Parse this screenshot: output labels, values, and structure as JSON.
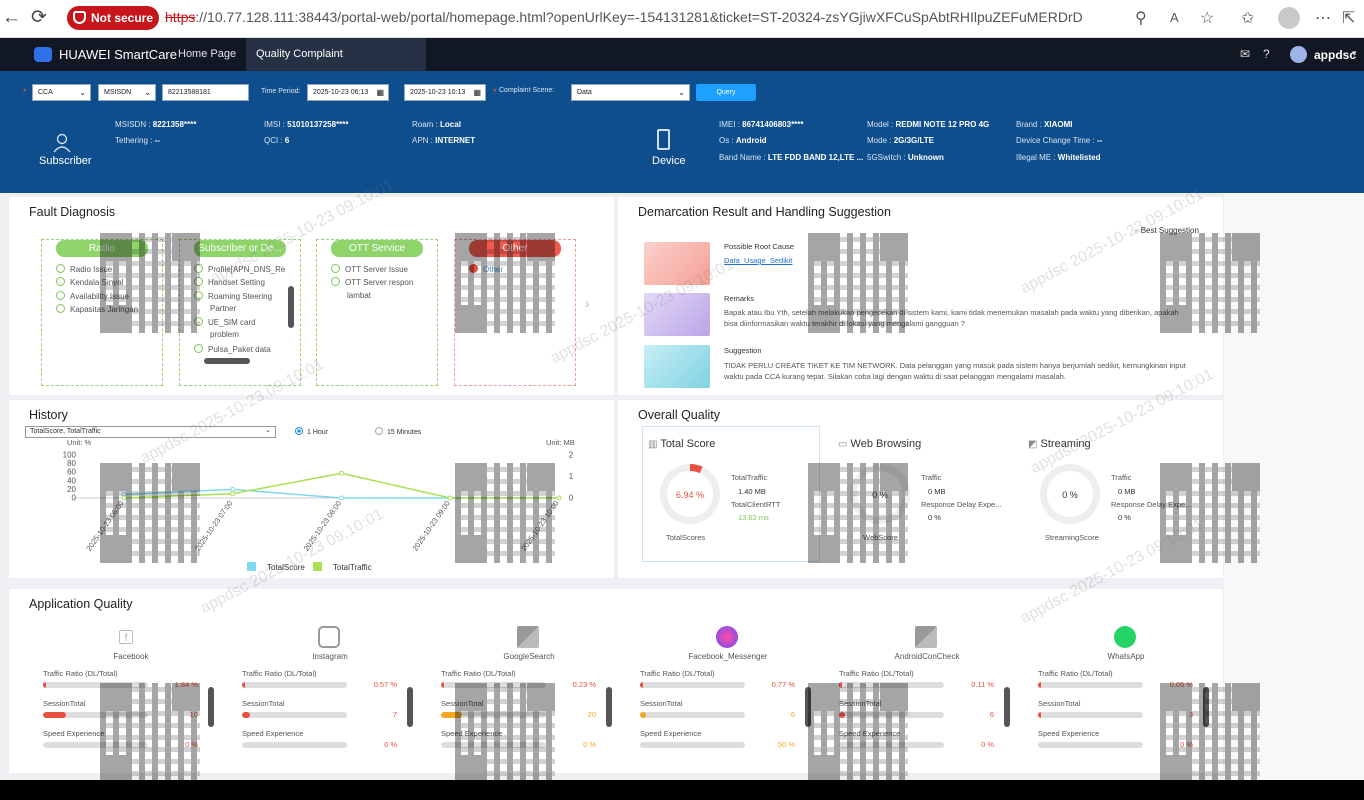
{
  "browser": {
    "badge": "Not secure",
    "url_scheme": "https",
    "url_rest": "://10.77.128.111:38443/portal-web/portal/homepage.html?openUrlKey=-154131281&ticket=ST-20324-zsYGjiwXFCuSpAbtRHIlpuZEFuMERDrD"
  },
  "topbar": {
    "brand": "HUAWEI SmartCare",
    "tabs": [
      {
        "label": "Home Page"
      },
      {
        "label": "Quality Complaint Handling(V..."
      }
    ],
    "close": "×",
    "user": "appdsc"
  },
  "query": {
    "channel": "CCA",
    "id_type": "MSISDN",
    "msisdn": "82213588181",
    "time_period_label": "Time Period:",
    "start": "2025-10-23 06:13",
    "end": "2025-10-23 10:13",
    "scene_label": "Complaint Scene:",
    "scene": "Data",
    "query_btn": "Query"
  },
  "subscriber": {
    "label": "Subscriber",
    "fields": [
      {
        "k": "MSISDN : ",
        "v": "8221358****"
      },
      {
        "k": "IMSI : ",
        "v": "51010137258****"
      },
      {
        "k": "Roam : ",
        "v": "Local"
      },
      {
        "k": "Tethering : ",
        "v": "--"
      },
      {
        "k": "QCI : ",
        "v": "6"
      },
      {
        "k": "APN : ",
        "v": "INTERNET"
      }
    ]
  },
  "device": {
    "label": "Device",
    "fields": [
      {
        "k": "IMEI : ",
        "v": "86741406803****"
      },
      {
        "k": "Model : ",
        "v": "REDMI NOTE 12 PRO 4G"
      },
      {
        "k": "Brand : ",
        "v": "XIAOMI"
      },
      {
        "k": "Os : ",
        "v": "Android"
      },
      {
        "k": "Mode : ",
        "v": "2G/3G/LTE"
      },
      {
        "k": "Device Change Time : ",
        "v": "--"
      },
      {
        "k": "Band Name : ",
        "v": "LTE FDD BAND 12,LTE ..."
      },
      {
        "k": "5GSwitch : ",
        "v": "Unknown"
      },
      {
        "k": "Illegal ME : ",
        "v": "Whitelisted"
      }
    ]
  },
  "fault": {
    "title": "Fault Diagnosis",
    "radio": {
      "title": "Radio",
      "items": [
        "Radio Issue",
        "Kendala Sinyal",
        "Availability Issue",
        "Kapasitas Jaringan"
      ]
    },
    "subscriber": {
      "title": "Subscriber or De...",
      "items": [
        "Profile[APN_DNS_Re",
        "Handset Setting",
        "Roaming Steering",
        "UE_SIM card",
        "Pulsa_Paket data"
      ],
      "subs": [
        "Partner",
        "problem"
      ]
    },
    "ott": {
      "title": "OTT Service",
      "items": [
        "OTT Server Issue",
        "OTT Server respon"
      ],
      "subs": [
        "lambat"
      ]
    },
    "other": {
      "title": "Other",
      "items": [
        "Other"
      ]
    }
  },
  "demarcation": {
    "title": "Demarcation Result and Handling Suggestion",
    "best": "Best Suggestion",
    "root_title": "Possible Root Cause",
    "root_link": "Data_Usage_Sedikit",
    "remarks_title": "Remarks",
    "remarks": "Bapak atau Ibu Yth, setelah melakukan pengecekan di sistem kami, kami tidak menemukan masalah pada waktu yang diberikan, apakah bisa diinformasikan waktu terakhir di lokasi yang mengalami gangguan ?",
    "suggestion_title": "Suggestion",
    "suggestion": "TIDAK PERLU CREATE TIKET KE TIM NETWORK. Data pelanggan yang masuk pada sistem hanya berjumlah sedikit, kemungkinan input waktu pada CCA kurang tepat. Silakan coba lagi dengan waktu di saat pelanggan mengalami masalah."
  },
  "history": {
    "title": "History",
    "selector": "TotalScore, TotalTraffic",
    "opt1": "1 Hour",
    "opt2": "15 Minutes",
    "unit_left": "Unit: %",
    "unit_right": "Unit: MB"
  },
  "chart_data": {
    "type": "line",
    "x": [
      "2025-10-23 06:00",
      "2025-10-23 07:00",
      "2025-10-23 08:00",
      "2025-10-23 09:00",
      "2025-10-23 10:00"
    ],
    "y_left_ticks": [
      100,
      80,
      60,
      40,
      20,
      0
    ],
    "y_right_ticks": [
      2,
      1,
      0
    ],
    "ylim_left": [
      0,
      100
    ],
    "ylim_right": [
      0,
      2
    ],
    "series": [
      {
        "name": "TotalScore",
        "axis": "left",
        "color": "#7fd8ef",
        "values": [
          8,
          20,
          0,
          0,
          0
        ]
      },
      {
        "name": "TotalTraffic",
        "axis": "right",
        "color": "#a9e052",
        "values": [
          0.0,
          0.2,
          1.15,
          0.0,
          0.0
        ]
      }
    ],
    "legend": "bottom"
  },
  "overall": {
    "title": "Overall Quality",
    "total": {
      "tab": "Total Score",
      "value": "6.94 %",
      "score": 6.94,
      "footer": "TotalScores",
      "k1": "TotalTraffic",
      "v1": "1.40 MB",
      "k2": "TotalClientRTT",
      "v2": "13.62 ms"
    },
    "web": {
      "tab": "Web Browsing",
      "value": "0 %",
      "footer": "WebScore",
      "k1": "Traffic",
      "v1": "0 MB",
      "k2": "Response Delay Expe...",
      "v2": "0 %"
    },
    "stream": {
      "tab": "Streaming",
      "value": "0 %",
      "footer": "StreamingScore",
      "k1": "Traffic",
      "v1": "0 MB",
      "k2": "Response Delay Expe...",
      "v2": "0 %"
    }
  },
  "apps": {
    "title": "Application Quality",
    "metric_labels": [
      "Traffic Ratio (DL/Total)",
      "SessionTotal",
      "Speed Experience"
    ],
    "list": [
      {
        "name": "Facebook",
        "traffic": "1.84 %",
        "traffic_ratio": 1.84,
        "session": "10",
        "session_frac": 0.22,
        "speed": "0 %",
        "speed_ratio": 0,
        "color": "#e8503f"
      },
      {
        "name": "Instagram",
        "traffic": "0.57 %",
        "traffic_ratio": 0.57,
        "session": "7",
        "session_frac": 0.08,
        "speed": "0 %",
        "speed_ratio": 0,
        "color": "#e8503f"
      },
      {
        "name": "GoogleSearch",
        "traffic": "0.23 %",
        "traffic_ratio": 0.23,
        "session": "20",
        "session_frac": 0.2,
        "speed": "0 %",
        "speed_ratio": 0,
        "color": "#f5a623"
      },
      {
        "name": "Facebook_Messenger",
        "traffic": "0.77 %",
        "traffic_ratio": 0.77,
        "session": "6",
        "session_frac": 0.06,
        "speed": "50 %",
        "speed_ratio": 0,
        "color": "#f5a623"
      },
      {
        "name": "AndroidConCheck",
        "traffic": "0.11 %",
        "traffic_ratio": 0.11,
        "session": "6",
        "session_frac": 0.06,
        "speed": "0 %",
        "speed_ratio": 0,
        "color": "#e8503f"
      },
      {
        "name": "WhatsApp",
        "traffic": "0.05 %",
        "traffic_ratio": 0.05,
        "session": "3",
        "session_frac": 0.03,
        "speed": "0 %",
        "speed_ratio": 0,
        "color": "#e8503f"
      }
    ]
  },
  "watermark": "appdsc 2025-10-23 09:10:01"
}
